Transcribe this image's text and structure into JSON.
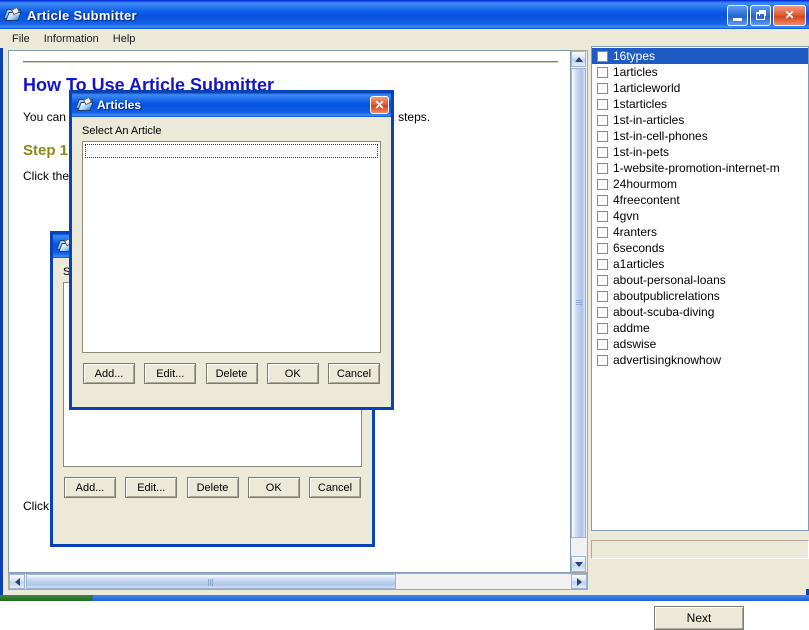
{
  "window": {
    "title": "Article Submitter",
    "icon": "book-icon",
    "buttons": {
      "minimize": "minimize-icon",
      "restore": "restore-icon",
      "close": "close-icon"
    }
  },
  "menubar": {
    "items": [
      {
        "label": "File"
      },
      {
        "label": "Information"
      },
      {
        "label": "Help"
      }
    ]
  },
  "document": {
    "heading1": "How To Use Article Submitter",
    "intro": "You can submit your articles to hundreds of article directories in only 2 steps.",
    "heading2": "Step 1",
    "step1": "Click the Add... button to open the Articles dialog box.",
    "step2": "Click Add... button to open Information dialog box."
  },
  "scrollbars": {
    "vertical": {
      "up": "scroll-up-arrow",
      "down": "scroll-down-arrow"
    },
    "horizontal": {
      "left": "scroll-left-arrow",
      "right": "scroll-right-arrow"
    }
  },
  "right_panel": {
    "next_label": "Next",
    "status_value": "",
    "sites": [
      {
        "label": "16types",
        "checked": false,
        "selected": true
      },
      {
        "label": "1articles",
        "checked": false,
        "selected": false
      },
      {
        "label": "1articleworld",
        "checked": false,
        "selected": false
      },
      {
        "label": "1starticles",
        "checked": false,
        "selected": false
      },
      {
        "label": "1st-in-articles",
        "checked": false,
        "selected": false
      },
      {
        "label": "1st-in-cell-phones",
        "checked": false,
        "selected": false
      },
      {
        "label": "1st-in-pets",
        "checked": false,
        "selected": false
      },
      {
        "label": "1-website-promotion-internet-m",
        "checked": false,
        "selected": false
      },
      {
        "label": "24hourmom",
        "checked": false,
        "selected": false
      },
      {
        "label": "4freecontent",
        "checked": false,
        "selected": false
      },
      {
        "label": "4gvn",
        "checked": false,
        "selected": false
      },
      {
        "label": "4ranters",
        "checked": false,
        "selected": false
      },
      {
        "label": "6seconds",
        "checked": false,
        "selected": false
      },
      {
        "label": "a1articles",
        "checked": false,
        "selected": false
      },
      {
        "label": "about-personal-loans",
        "checked": false,
        "selected": false
      },
      {
        "label": "aboutpublicrelations",
        "checked": false,
        "selected": false
      },
      {
        "label": "about-scuba-diving",
        "checked": false,
        "selected": false
      },
      {
        "label": "addme",
        "checked": false,
        "selected": false
      },
      {
        "label": "adswise",
        "checked": false,
        "selected": false
      },
      {
        "label": "advertisingknowhow",
        "checked": false,
        "selected": false
      }
    ]
  },
  "dialog_front": {
    "title": "Articles",
    "icon": "book-icon",
    "close": "close-icon",
    "label": "Select An Article",
    "list_items": [],
    "buttons": [
      {
        "label": "Add..."
      },
      {
        "label": "Edit..."
      },
      {
        "label": "Delete"
      },
      {
        "label": "OK"
      },
      {
        "label": "Cancel"
      }
    ]
  },
  "dialog_back": {
    "title": "Articles",
    "icon": "book-icon",
    "label": "Select An Article",
    "list_items": [],
    "buttons": [
      {
        "label": "Add..."
      },
      {
        "label": "Edit..."
      },
      {
        "label": "Delete"
      },
      {
        "label": "OK"
      },
      {
        "label": "Cancel"
      }
    ]
  },
  "colors": {
    "titlebar_blue": "#0a52de",
    "dialog_border": "#0a41b5",
    "selection_blue": "#1f5bc4",
    "window_face": "#ece9d8",
    "heading1": "#1414cc",
    "heading2": "#8a8a14",
    "close_red": "#d24422"
  }
}
